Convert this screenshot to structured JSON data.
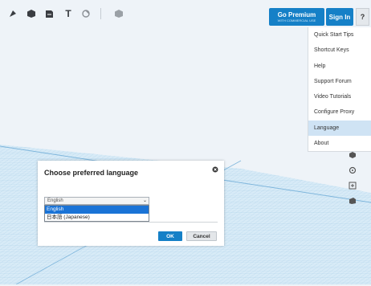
{
  "toolbar": {
    "icons": [
      "shape-tool-icon",
      "solid-tool-icon",
      "import-tool-icon",
      "text-tool-icon",
      "paint-tool-icon",
      "group-tool-icon"
    ],
    "text_tool_glyph": "T",
    "premium_label": "Go Premium",
    "premium_sublabel": "WITH COMMERCIAL USE",
    "signin_label": "Sign In",
    "help_label": "?"
  },
  "help_menu": {
    "items": [
      {
        "label": "Quick Start Tips"
      },
      {
        "label": "Shortcut Keys"
      },
      {
        "label": "Help"
      },
      {
        "label": "Support Forum"
      },
      {
        "label": "Video Tutorials"
      },
      {
        "label": "Configure Proxy"
      },
      {
        "label": "Language",
        "selected": true
      },
      {
        "label": "About"
      }
    ]
  },
  "side_tools": [
    "view-icon",
    "orbit-icon",
    "zoom-icon",
    "layers-icon"
  ],
  "dialog": {
    "title": "Choose preferred language",
    "select_value": "English",
    "options": [
      {
        "label": "English",
        "selected": true
      },
      {
        "label": "日本語 (Japanese)",
        "selected": false
      }
    ],
    "ok_label": "OK",
    "cancel_label": "Cancel"
  },
  "colors": {
    "accent": "#1580c7",
    "workspace": "#eef3f8",
    "grid": "#9ec8e4",
    "selection": "#1a73d6",
    "menu_highlight": "#cfe3f4"
  }
}
